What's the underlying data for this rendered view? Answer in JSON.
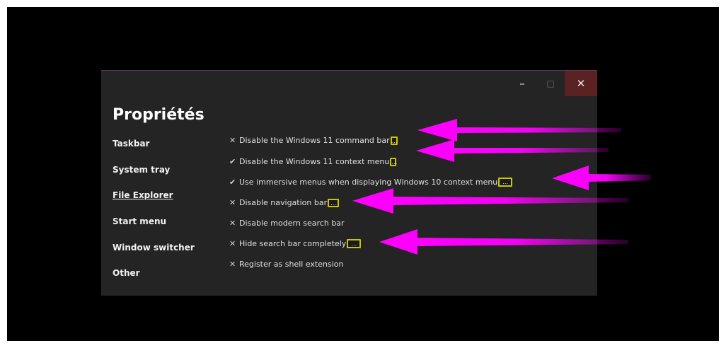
{
  "window": {
    "title": "Propriétés",
    "controls": {
      "minimize": "–",
      "maximize": "□",
      "close": "✕"
    }
  },
  "sidebar": {
    "items": [
      {
        "label": "Taskbar"
      },
      {
        "label": "System tray"
      },
      {
        "label": "File Explorer",
        "selected": true
      },
      {
        "label": "Start menu"
      },
      {
        "label": "Window switcher"
      },
      {
        "label": "Other"
      }
    ]
  },
  "settings": [
    {
      "state": "off",
      "mark": "✕",
      "label": "Disable the Windows 11 command bar",
      "more": "…"
    },
    {
      "state": "on",
      "mark": "✔",
      "label": "Disable the Windows 11 context menu",
      "more": "…"
    },
    {
      "state": "on",
      "mark": "✔",
      "label": "Use immersive menus when displaying Windows 10 context menu",
      "more": "…"
    },
    {
      "state": "off",
      "mark": "✕",
      "label": "Disable navigation bar",
      "more": "…"
    },
    {
      "state": "off",
      "mark": "✕",
      "label": "Disable modern search bar"
    },
    {
      "state": "off",
      "mark": "✕",
      "label": "Hide search bar completely",
      "more": "…"
    },
    {
      "state": "off",
      "mark": "✕",
      "label": "Register as shell extension"
    }
  ],
  "colors": {
    "window_bg": "#242424",
    "annotation_arrow": "#ff00ff",
    "highlight_box": "#c9c500",
    "close_hover": "#5a2222"
  }
}
